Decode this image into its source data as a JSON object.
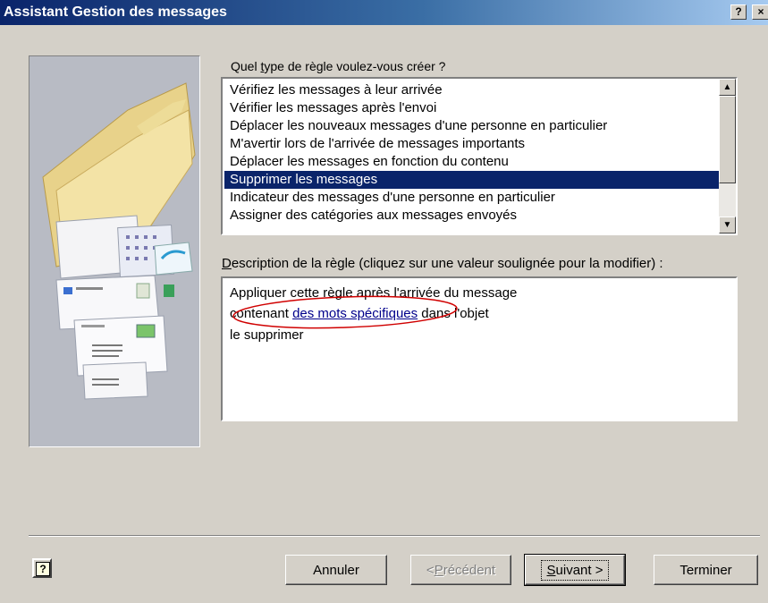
{
  "window": {
    "title": "Assistant Gestion des messages",
    "help_glyph": "?",
    "close_glyph": "×"
  },
  "rule_type": {
    "label_before": "Quel ",
    "label_accel": "t",
    "label_after": "ype de règle voulez-vous créer ?",
    "items": [
      "Vérifiez les messages à leur arrivée",
      "Vérifier les messages après l'envoi",
      "Déplacer les nouveaux messages d'une personne en particulier",
      "M'avertir lors de l'arrivée de messages importants",
      "Déplacer les messages en fonction du contenu",
      "Supprimer les messages",
      "Indicateur des messages d'une personne en particulier",
      "Assigner des catégories aux messages envoyés"
    ],
    "selected_index": 5
  },
  "description": {
    "label_accel": "D",
    "label_after": "escription de la règle (cliquez sur une valeur soulignée pour la modifier) :",
    "line1": "Appliquer cette règle après l'arrivée du message",
    "line2_before": "contenant ",
    "line2_link": "des mots spécifiques",
    "line2_after": " dans l'objet",
    "line3": "le supprimer"
  },
  "annotation": {
    "ellipse_color": "#d00000"
  },
  "buttons": {
    "help_glyph": "?",
    "cancel": "Annuler",
    "prev_before": "< ",
    "prev_accel": "P",
    "prev_after": "récédent",
    "next_accel": "S",
    "next_after": "uivant >",
    "finish": "Terminer"
  },
  "colors": {
    "titlebar_start": "#0a246a",
    "titlebar_end": "#a6caf0",
    "selection": "#0a246a",
    "face": "#d4d0c8",
    "link": "#00008b"
  }
}
